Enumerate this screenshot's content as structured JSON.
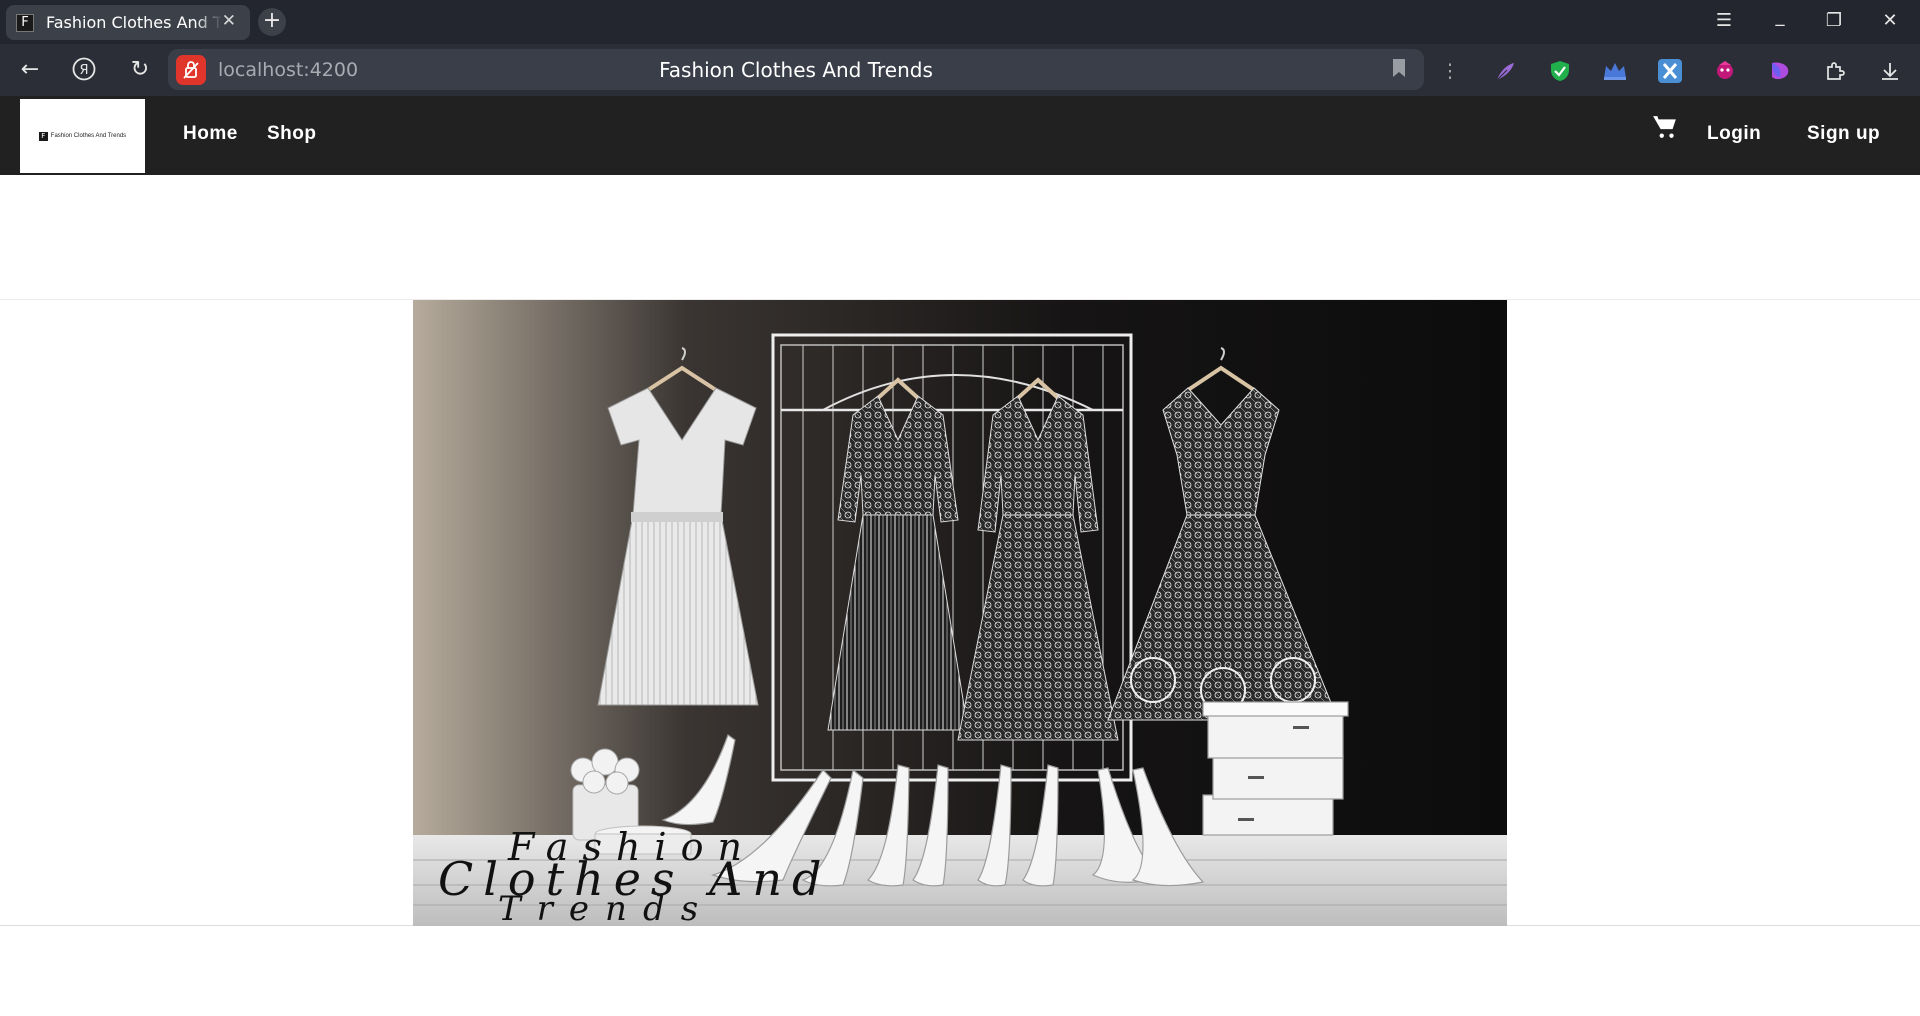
{
  "browser": {
    "tab_title": "Fashion Clothes And Trends",
    "tab_favicon_letter": "F",
    "url": "localhost:4200",
    "page_title": "Fashion Clothes And Trends",
    "extensions": [
      "feather-extension-icon",
      "shield-check-extension-icon",
      "crown-extension-icon",
      "x-extension-icon",
      "anime-extension-icon",
      "purple-blob-extension-icon",
      "puzzle-extensions-icon",
      "download-icon"
    ]
  },
  "site": {
    "logo_text": "Fashion Clothes And Trends",
    "logo_letter": "F",
    "nav": {
      "home": "Home",
      "shop": "Shop"
    },
    "auth": {
      "login": "Login",
      "signup": "Sign up"
    }
  },
  "hero": {
    "overlay_line1": "Fashion",
    "overlay_line2": "Clothes And",
    "overlay_line3": "Trends"
  },
  "colors": {
    "navbar": "#212121",
    "chrome_tabbar": "#23262e",
    "chrome_toolbar": "#2b2e37"
  }
}
